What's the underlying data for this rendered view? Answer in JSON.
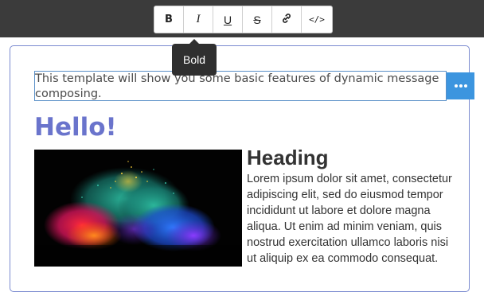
{
  "toolbar": {
    "buttons": [
      {
        "name": "bold",
        "label": "B",
        "icon": "bold-icon"
      },
      {
        "name": "italic",
        "label": "I",
        "icon": "italic-icon"
      },
      {
        "name": "underline",
        "label": "U",
        "icon": "underline-icon"
      },
      {
        "name": "strikethrough",
        "label": "S",
        "icon": "strikethrough-icon"
      },
      {
        "name": "link",
        "label": "",
        "icon": "link-icon"
      },
      {
        "name": "code",
        "label": "</>",
        "icon": "code-icon"
      }
    ],
    "tooltip": "Bold"
  },
  "message": {
    "intro_text": "This template will show you some basic features of dynamic message composing.",
    "more_button_icon": "more-horizontal-icon",
    "greeting": "Hello!",
    "heading": "Heading",
    "body_text": "Lorem ipsum dolor sit amet, consectetur adipiscing elit, sed do eiusmod tempor incididunt ut labore et dolore magna aliqua. Ut enim ad minim veniam, quis nostrud exercitation ullamco laboris nisi ut aliquip ex ea commodo consequat.",
    "image_description": "colorful-powder-explosion"
  },
  "colors": {
    "topbar": "#3b3b3b",
    "accent": "#6a74cc",
    "action_button": "#3c95df",
    "selection_border": "#5a90c8"
  }
}
